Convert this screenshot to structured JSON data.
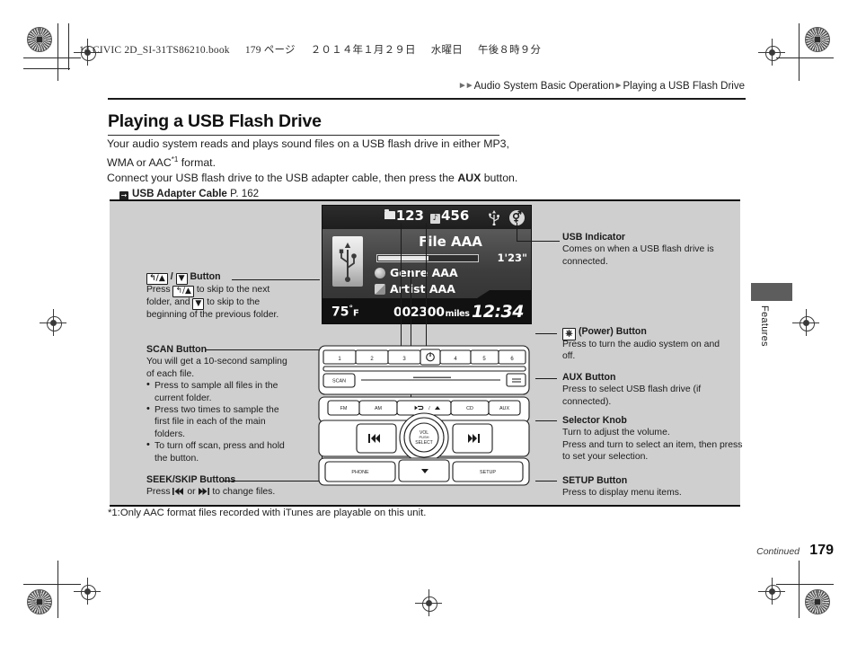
{
  "print_header": {
    "book": "14 CIVIC 2D_SI-31TS86210.book",
    "page_label": "179 ページ",
    "date": "２０１４年１月２９日",
    "weekday": "水曜日",
    "time": "午後８時９分"
  },
  "breadcrumb": {
    "parent": "Audio System Basic Operation",
    "current": "Playing a USB Flash Drive"
  },
  "title": "Playing a USB Flash Drive",
  "intro": {
    "line1": "Your audio system reads and plays sound files on a USB flash drive in either MP3,",
    "line2a": "WMA or AAC",
    "line2_sup": "*1",
    "line2b": " format.",
    "line3a": "Connect your USB flash drive to the USB adapter cable, then press the ",
    "line3_bold": "AUX",
    "line3b": " button.",
    "ref_label": "USB Adapter Cable",
    "ref_page": "P. 162"
  },
  "display": {
    "folder_number": "123",
    "track_number": "456",
    "file_name": "File AAA",
    "play_time": "1'23\"",
    "genre": "Genre AAA",
    "artist": "Artist AAA",
    "temperature": "75",
    "temperature_unit": "F",
    "odometer": "002300",
    "odometer_unit": "miles",
    "clock": "12:34"
  },
  "callouts": {
    "folder_button": {
      "heading_a": "/",
      "heading_b": "Button",
      "key_up": "↰/▲",
      "key_down": "▼",
      "body_a": "Press",
      "body_b": "to skip to the next folder, and",
      "body_c": "to skip to the beginning of the previous folder."
    },
    "scan": {
      "heading": "SCAN Button",
      "intro": "You will get a 10-second sampling of each file.",
      "bullets": [
        "Press to sample all files in the current folder.",
        "Press two times to sample the first file in each of the main folders.",
        "To turn off scan, press and hold the button."
      ]
    },
    "seek_skip": {
      "heading": "SEEK/SKIP Buttons",
      "body_a": "Press",
      "body_b": "or",
      "body_c": "to change files."
    },
    "usb_indicator": {
      "heading": "USB Indicator",
      "body": "Comes on when a USB flash drive is connected."
    },
    "power": {
      "heading": "(Power) Button",
      "body": "Press to turn the audio system on and off."
    },
    "aux": {
      "heading": "AUX Button",
      "body": "Press to select USB flash drive (if connected)."
    },
    "selector_knob": {
      "heading": "Selector Knob",
      "body1": "Turn to adjust the volume.",
      "body2": "Press and turn to select an item, then press to set your selection."
    },
    "setup": {
      "heading": "SETUP Button",
      "body": "Press to display menu items."
    }
  },
  "faceplate": {
    "presets": [
      "1",
      "2",
      "3",
      "4",
      "5",
      "6"
    ],
    "scan": "SCAN",
    "fm": "FM",
    "am": "AM",
    "cd": "CD",
    "aux": "AUX",
    "folder_up": "/",
    "knob_line1": "VOL",
    "knob_line2": "PUSH",
    "knob_line3": "SELECT",
    "phone": "PHONE",
    "setup": "SETUP"
  },
  "footnote": "*1:Only AAC format files recorded with iTunes are playable on this unit.",
  "side_tab": "Features",
  "footer": {
    "continued": "Continued",
    "page_number": "179"
  }
}
